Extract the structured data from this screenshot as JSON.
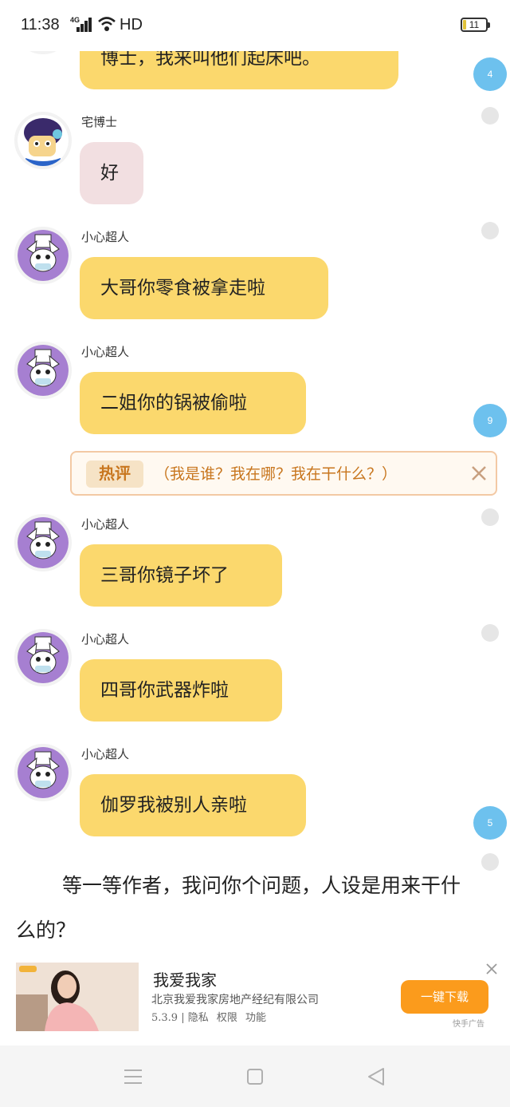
{
  "status_bar": {
    "time": "11:38",
    "network": "4G",
    "hd": "HD",
    "battery": "11"
  },
  "messages": [
    {
      "name": "",
      "text": "博士，我来叫他们起床吧。",
      "style": "yellow",
      "avatar": "purple-hair-avatar"
    },
    {
      "name": "宅博士",
      "text": "好",
      "style": "pink",
      "avatar": "doctor-avatar"
    },
    {
      "name": "小心超人",
      "text": "大哥你零食被拿走啦",
      "style": "yellow",
      "avatar": "robot-avatar"
    },
    {
      "name": "小心超人",
      "text": "二姐你的锅被偷啦",
      "style": "yellow",
      "avatar": "robot-avatar"
    },
    {
      "name": "小心超人",
      "text": "三哥你镜子坏了",
      "style": "yellow",
      "avatar": "robot-avatar"
    },
    {
      "name": "小心超人",
      "text": "四哥你武器炸啦",
      "style": "yellow",
      "avatar": "robot-avatar"
    },
    {
      "name": "小心超人",
      "text": "伽罗我被别人亲啦",
      "style": "yellow",
      "avatar": "robot-avatar"
    }
  ],
  "comment_counts": [
    "4",
    "9",
    "5"
  ],
  "hot_comment": {
    "tag": "热评",
    "text": "（我是谁？我在哪？我在干什么？）"
  },
  "story_text": "等一等作者，我问你个问题，人设是用来干什么的？",
  "ad": {
    "title": "我爱我家",
    "company": "北京我爱我家房地产经纪有限公司",
    "version": "5.3.9",
    "links": [
      "隐私",
      "权限",
      "功能"
    ],
    "button": "一键下载",
    "source": "快手广告"
  },
  "colors": {
    "bubble_yellow": "#fbd86d",
    "bubble_pink": "#f2dfe1",
    "count_badge": "#6dc1ee",
    "hot_comment": "#c8761e",
    "ad_button": "#fb9b1c"
  }
}
